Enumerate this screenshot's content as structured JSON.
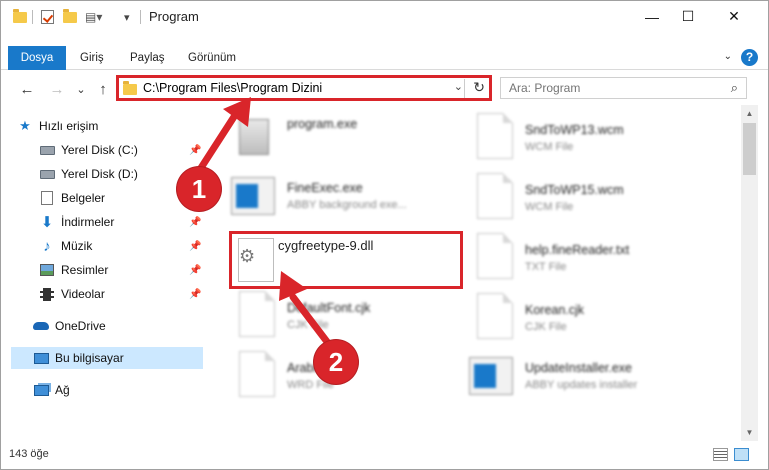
{
  "window": {
    "title": "Program",
    "minimize_label": "—",
    "maximize_label": "☐",
    "close_label": "✕"
  },
  "ribbon": {
    "tabs": [
      "Dosya",
      "Giriş",
      "Paylaş",
      "Görünüm"
    ],
    "help_label": "?",
    "file_tab_color": "#1979ca"
  },
  "navigation": {
    "back_label": "←",
    "forward_label": "→",
    "recent_label": "⌄",
    "up_label": "↑",
    "address_path": "C:\\Program Files\\Program Dizini",
    "refresh_label": "↻",
    "search_placeholder": "Ara: Program"
  },
  "sidebar": {
    "items": [
      {
        "label": "Hızlı erişim",
        "icon": "star-icon"
      },
      {
        "label": "Yerel Disk (C:)",
        "icon": "drive-icon"
      },
      {
        "label": "Yerel Disk (D:)",
        "icon": "drive-icon"
      },
      {
        "label": "Belgeler",
        "icon": "document-icon"
      },
      {
        "label": "İndirmeler",
        "icon": "download-icon"
      },
      {
        "label": "Müzik",
        "icon": "music-icon"
      },
      {
        "label": "Resimler",
        "icon": "pictures-icon"
      },
      {
        "label": "Videolar",
        "icon": "videos-icon"
      },
      {
        "label": "OneDrive",
        "icon": "onedrive-icon"
      },
      {
        "label": "Bu bilgisayar",
        "icon": "this-pc-icon"
      },
      {
        "label": "Ağ",
        "icon": "network-icon"
      }
    ]
  },
  "files": {
    "left": [
      {
        "name": "program.exe",
        "type": ""
      },
      {
        "name": "FineExec.exe",
        "type": "ABBY background exe..."
      },
      {
        "name": "cygfreetype-9.dll",
        "type": ""
      },
      {
        "name": "DefaultFont.cjk",
        "type": "CJK File"
      },
      {
        "name": "Arabic.cjk",
        "type": "WRD File"
      }
    ],
    "right": [
      {
        "name": "SndToWP13.wcm",
        "type": "WCM File"
      },
      {
        "name": "SndToWP15.wcm",
        "type": "WCM File"
      },
      {
        "name": "help.fineReader.txt",
        "type": "TXT File"
      },
      {
        "name": "Korean.cjk",
        "type": "CJK File"
      },
      {
        "name": "UpdateInstaller.exe",
        "type": "ABBY updates installer"
      }
    ]
  },
  "status": {
    "item_count": "143 öğe"
  },
  "annotations": {
    "step1": "1",
    "step2": "2",
    "accent_color": "#d9252a"
  }
}
